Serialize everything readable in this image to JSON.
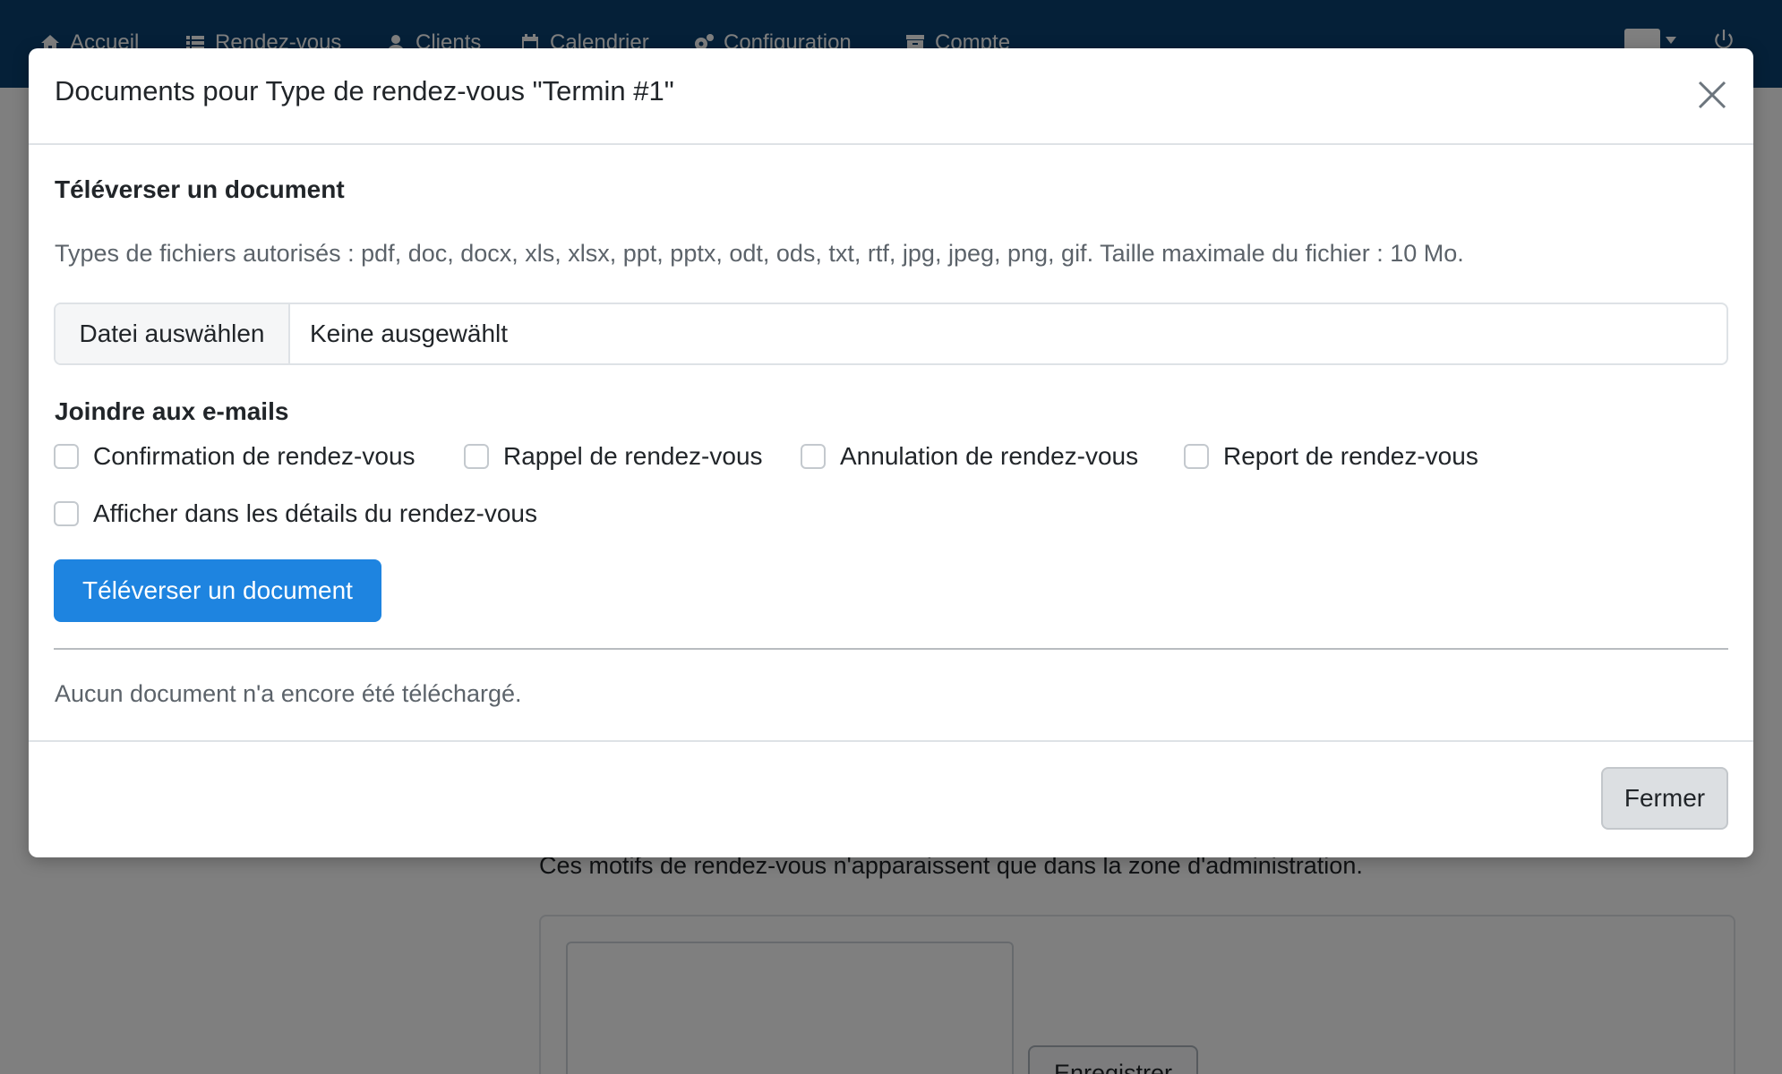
{
  "navbar": {
    "items": [
      {
        "label": "Accueil",
        "icon": "home-icon"
      },
      {
        "label": "Rendez-vous",
        "icon": "list-icon"
      },
      {
        "label": "Clients",
        "icon": "user-icon"
      },
      {
        "label": "Calendrier",
        "icon": "calendar-icon"
      },
      {
        "label": "Configuration",
        "icon": "cogs-icon"
      },
      {
        "label": "Compte",
        "icon": "archive-icon"
      }
    ],
    "language_icon": "language-icon",
    "logout_icon": "power-icon",
    "background_color": "#0b4170"
  },
  "background": {
    "description_text": "Ces motifs de rendez-vous n'apparaissent que dans la zone d'administration.",
    "save_button_label": "Enregistrer"
  },
  "modal": {
    "title": "Documents pour Type de rendez-vous \"Termin #1\"",
    "upload_heading": "Téléverser un document",
    "allowed_types_text": "Types de fichiers autorisés : pdf, doc, docx, xls, xlsx, ppt, pptx, odt, ods, txt, rtf, jpg, jpeg, png, gif. Taille maximale du fichier : 10 Mo.",
    "file_input": {
      "button_label": "Datei auswählen",
      "value": "Keine ausgewählt"
    },
    "attach_heading": "Joindre aux e-mails",
    "checkboxes": [
      {
        "label": "Confirmation de rendez-vous",
        "checked": false
      },
      {
        "label": "Rappel de rendez-vous",
        "checked": false
      },
      {
        "label": "Annulation de rendez-vous",
        "checked": false
      },
      {
        "label": "Report de rendez-vous",
        "checked": false
      },
      {
        "label": "Afficher dans les détails du rendez-vous",
        "checked": false
      }
    ],
    "upload_button_label": "Téléverser un document",
    "empty_message": "Aucun document n'a encore été téléchargé.",
    "close_button_label": "Fermer",
    "primary_color": "#1e84e0"
  }
}
